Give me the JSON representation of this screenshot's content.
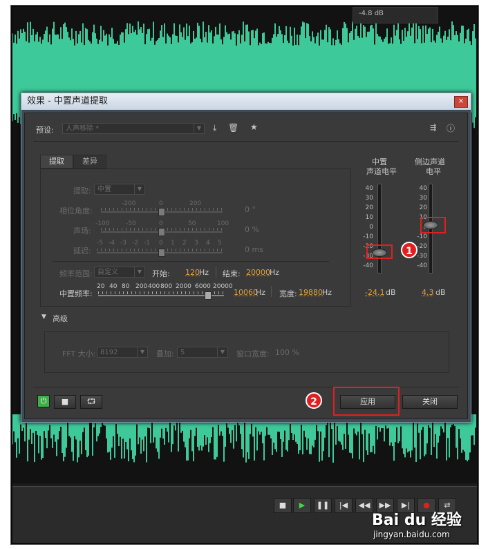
{
  "topbar": {
    "value": "-4.8 dB"
  },
  "dialog": {
    "title": "效果 - 中置声道提取",
    "close": "×",
    "preset": {
      "label": "预设:",
      "value": "人声移除 *"
    },
    "tabs": [
      "提取",
      "差异"
    ],
    "extract": {
      "label": "提取:",
      "value": "中置"
    },
    "phase": {
      "label": "相位角度:",
      "ticks": [
        "-200",
        "0",
        "200"
      ],
      "value": "0 °"
    },
    "pan": {
      "label": "声场:",
      "ticks": [
        "-100",
        "-50",
        "0",
        "50",
        "100"
      ],
      "value": "0 %"
    },
    "delay": {
      "label": "延迟:",
      "ticks": [
        "-5",
        "-4",
        "-3",
        "-2",
        "-1",
        "0",
        "1",
        "2",
        "3",
        "4",
        "5"
      ],
      "value": "0 ms"
    },
    "freq_range": {
      "label": "频率范围:",
      "value": "自定义",
      "start_label": "开始:",
      "start_value": "120",
      "start_unit": "Hz",
      "end_label": "结束:",
      "end_value": "20000",
      "end_unit": "Hz"
    },
    "center_freq": {
      "label": "中置频率:",
      "ticks": [
        "20",
        "40",
        "80",
        "200",
        "400",
        "800",
        "2000",
        "6000",
        "20000"
      ],
      "value": "10060",
      "unit": "Hz",
      "width_label": "宽度:",
      "width_value": "19880",
      "width_unit": "Hz"
    },
    "meters": {
      "center_title_1": "中置",
      "center_title_2": "声道电平",
      "side_title_1": "侧边声道",
      "side_title_2": "电平",
      "scale": [
        "40",
        "30",
        "20",
        "10",
        "0",
        "-10",
        "-20",
        "-30",
        "-40"
      ],
      "center_value": "-24.1",
      "side_value": "4.3",
      "unit": "dB"
    },
    "advanced": {
      "label": "高级",
      "fft_label": "FFT 大小:",
      "fft_value": "8192",
      "overlap_label": "叠加:",
      "overlap_value": "5",
      "window_label": "窗口宽度:",
      "window_value": "100 %"
    },
    "buttons": {
      "apply": "应用",
      "close": "关闭"
    },
    "badges": [
      "1",
      "2"
    ]
  },
  "watermark": {
    "logo": "Bai du 经验",
    "url": "jingyan.baidu.com"
  },
  "colors": {
    "waveform": "#3ec99a",
    "accent": "#e3a23a",
    "highlight": "#e02020",
    "power": "#3fae49"
  }
}
